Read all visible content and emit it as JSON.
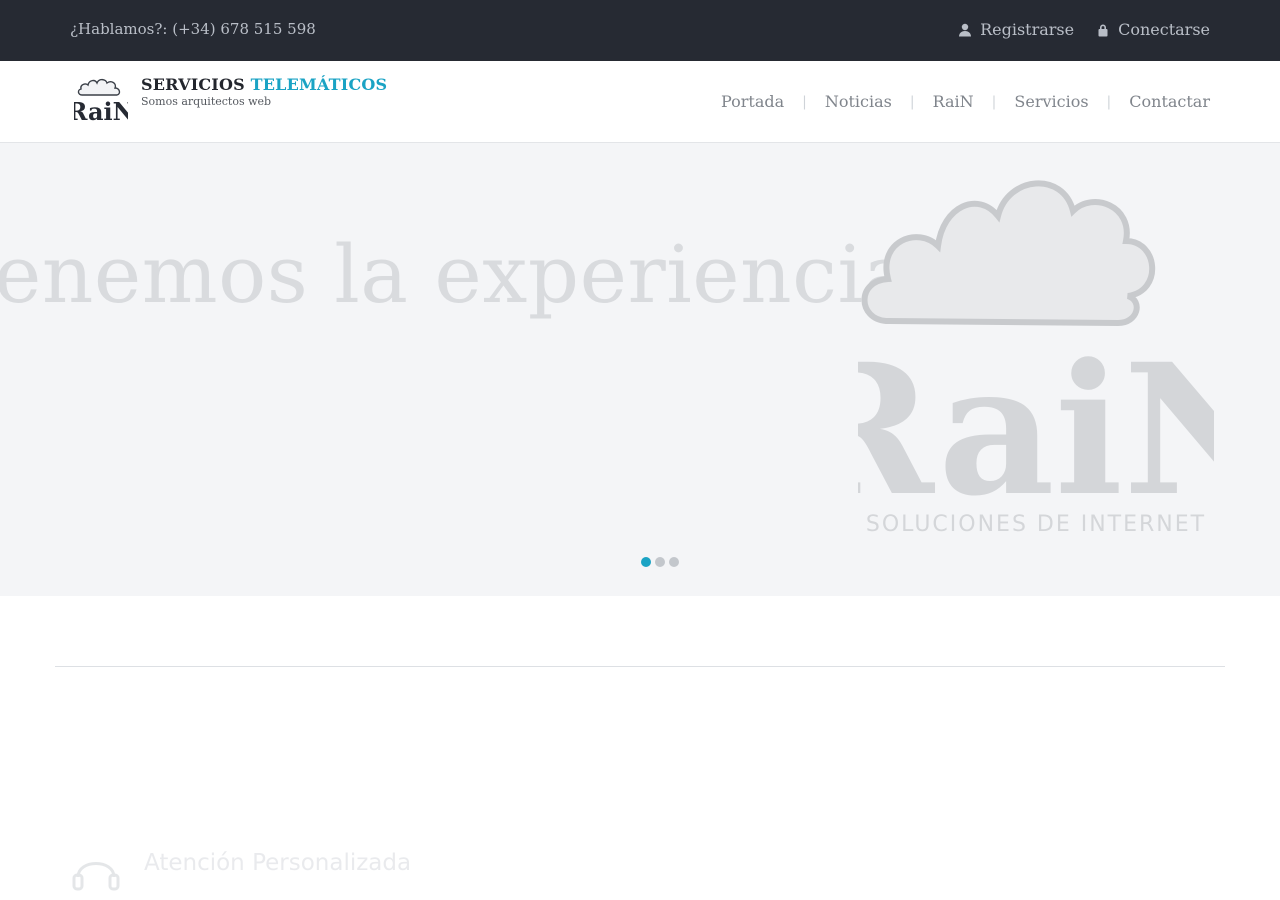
{
  "topbar": {
    "phone": "¿Hablamos?: (+34) 678 515 598",
    "register_label": "Registrarse",
    "login_label": "Conectarse"
  },
  "brand": {
    "name_main": "SERVICIOS",
    "name_accent": "TELEMÁTICOS",
    "tagline": "Somos arquitectos web",
    "logo_text": "RaiN",
    "accent_color": "#1aa3c4"
  },
  "nav": {
    "items": [
      "Portada",
      "Noticias",
      "RaiN",
      "Servicios",
      "Contactar"
    ],
    "separator": "|"
  },
  "hero": {
    "headline": "enemos la experiencia",
    "logo_text": "RaiN",
    "logo_subtitle": "SOLUCIONES DE INTERNET",
    "slide_count": 3,
    "active_slide": 1
  },
  "feature": {
    "title": "Atención Personalizada",
    "icon": "headset-icon"
  }
}
